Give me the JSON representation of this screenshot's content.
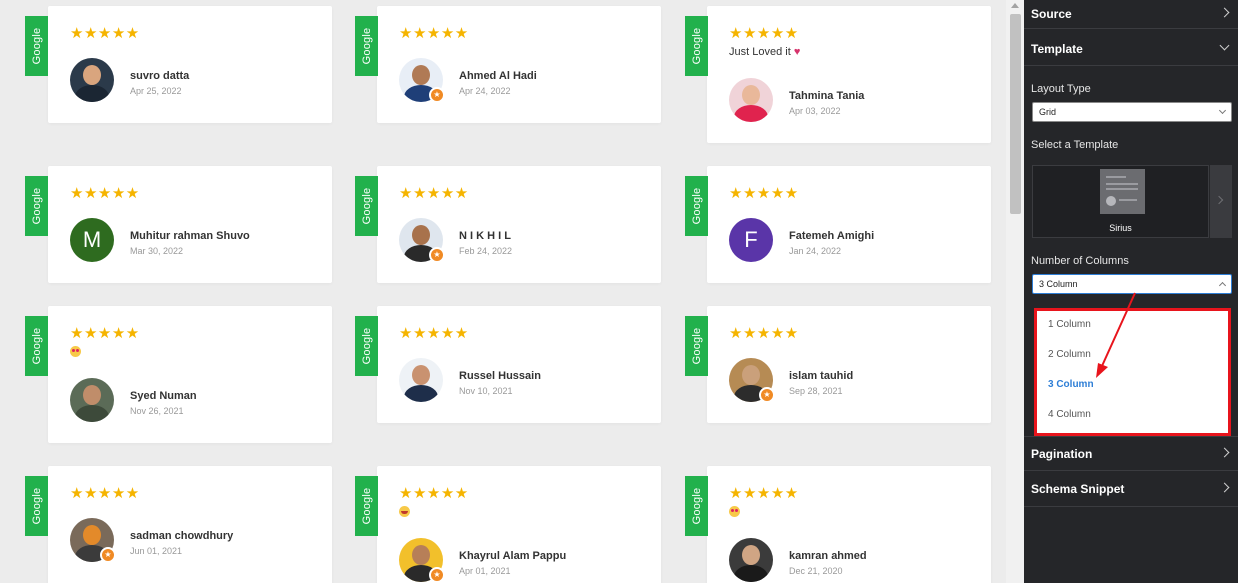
{
  "colors": {
    "google_tag": "#22b14c",
    "star": "#f5b400",
    "panel_bg": "#252629",
    "highlight": "#e8141c",
    "selected_option": "#2e7ed6"
  },
  "review_source_label": "Google",
  "stars": "★★★★★",
  "reviews": [
    {
      "name": "suvro datta",
      "date": "Apr 25, 2022",
      "snippet": ""
    },
    {
      "name": "Ahmed Al Hadi",
      "date": "Apr 24, 2022",
      "snippet": ""
    },
    {
      "name": "Tahmina Tania",
      "date": "Apr 03, 2022",
      "snippet": "Just Loved it",
      "snippet_emoji": "heart"
    },
    {
      "name": "Muhitur rahman Shuvo",
      "date": "Mar 30, 2022",
      "snippet": "",
      "avatar_letter": "M"
    },
    {
      "name": "N I K H I L",
      "date": "Feb 24, 2022",
      "snippet": ""
    },
    {
      "name": "Fatemeh Amighi",
      "date": "Jan 24, 2022",
      "snippet": "",
      "avatar_letter": "F"
    },
    {
      "name": "Syed Numan",
      "date": "Nov 26, 2021",
      "snippet": "",
      "snippet_emoji": "smiling-face-with-heart-eyes"
    },
    {
      "name": "Russel Hussain",
      "date": "Nov 10, 2021",
      "snippet": ""
    },
    {
      "name": "islam tauhid",
      "date": "Sep 28, 2021",
      "snippet": ""
    },
    {
      "name": "sadman chowdhury",
      "date": "Jun 01, 2021",
      "snippet": ""
    },
    {
      "name": "Khayrul Alam Pappu",
      "date": "Apr 01, 2021",
      "snippet": "",
      "snippet_emoji": "grinning-face"
    },
    {
      "name": "kamran ahmed",
      "date": "Dec 21, 2020",
      "snippet": "",
      "snippet_emoji": "smiling-face-with-heart-eyes"
    }
  ],
  "panel": {
    "source": {
      "title": "Source",
      "icon": "chevron-right-icon"
    },
    "template": {
      "title": "Template",
      "icon": "chevron-down-icon",
      "layout_type_label": "Layout Type",
      "layout_type_value": "Grid",
      "select_template_label": "Select a Template",
      "template_name": "Sirius",
      "columns_label": "Number of Columns",
      "columns_value": "3 Column",
      "column_options": [
        "1 Column",
        "2 Column",
        "3 Column",
        "4 Column"
      ],
      "selected_option": "3 Column"
    },
    "pagination": {
      "title": "Pagination",
      "icon": "chevron-right-icon"
    },
    "schema": {
      "title": "Schema Snippet",
      "icon": "chevron-right-icon"
    }
  }
}
